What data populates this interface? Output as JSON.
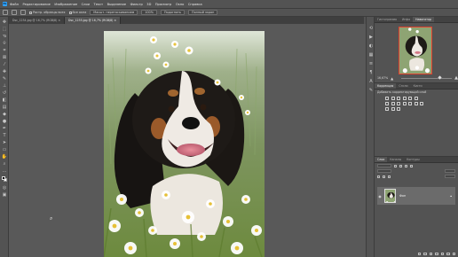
{
  "menubar": {
    "items": [
      "Файл",
      "Редактирование",
      "Изображение",
      "Слои",
      "Текст",
      "Выделение",
      "Фильтр",
      "3D",
      "Просмотр",
      "Окно",
      "Справка"
    ]
  },
  "options": {
    "checks": [
      "Растр. образцы всех",
      "Все окна"
    ],
    "buttons": [
      "Масшт. перетаскиванием",
      "100%",
      "Подогнать",
      "Полный экран"
    ]
  },
  "tabs": [
    {
      "label": "Dsc_1234.jpg @ 16,7% (RGB/8) ×"
    },
    {
      "label": "Dsc_1235.jpg @ 16,7% (RGB/8) ×"
    }
  ],
  "panels": {
    "navigator_tabs": [
      "Гистограмма",
      "Инфо",
      "Навигатор"
    ],
    "zoom": "16,67%",
    "adjust_tabs": [
      "Коррекция",
      "Стили",
      "Кисти"
    ],
    "adjust_title": "Добавить корректирующий слой",
    "layers_tabs": [
      "Слои",
      "Каналы",
      "Контуры"
    ],
    "layer_name": "Фон"
  },
  "colors": {
    "ui_bg": "#535353",
    "canvas_bg": "#595959",
    "nav_frame": "#e2422e",
    "ps_blue": "#2fa3ff"
  }
}
